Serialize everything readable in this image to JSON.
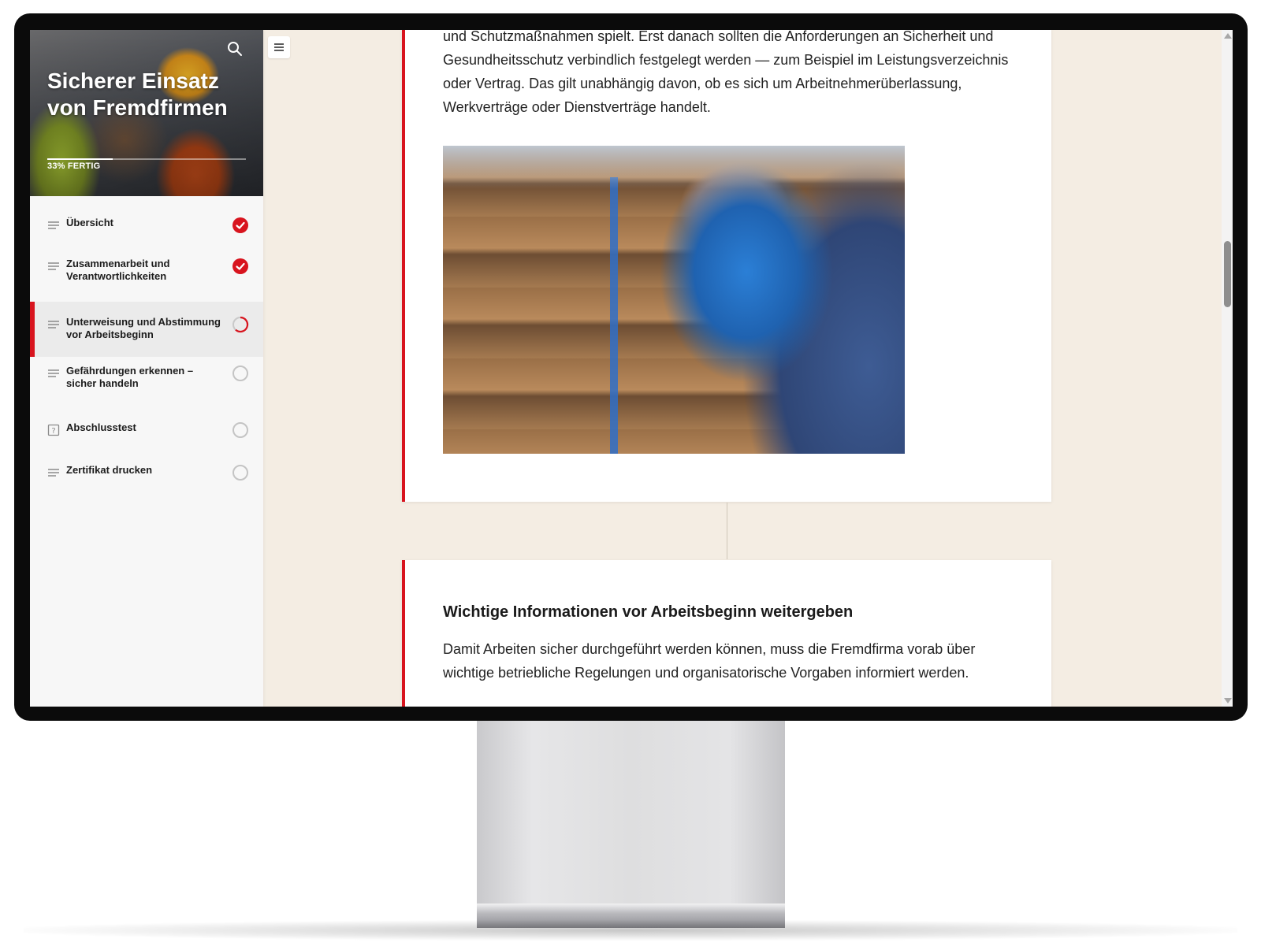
{
  "course": {
    "title": "Sicherer Einsatz von Fremdfirmen",
    "progress_label": "33% FERTIG",
    "progress_fraction": 0.33
  },
  "sidebar": {
    "items": [
      {
        "label": "Übersicht",
        "icon": "lines-icon",
        "status": "complete"
      },
      {
        "label": "Zusammenarbeit und Verantwortlichkeiten",
        "icon": "lines-icon",
        "status": "complete"
      },
      {
        "label": "Unterweisung und Abstimmung vor Arbeitsbeginn",
        "icon": "lines-icon",
        "status": "in-progress",
        "active": true
      },
      {
        "label": "Gefährdungen erkennen – sicher handeln",
        "icon": "lines-icon",
        "status": "incomplete"
      },
      {
        "label": "Abschlusstest",
        "icon": "quiz-icon",
        "status": "incomplete"
      },
      {
        "label": "Zertifikat drucken",
        "icon": "lines-icon",
        "status": "incomplete"
      }
    ]
  },
  "content": {
    "block1_text": "und Schutzmaßnahmen spielt. Erst danach sollten die Anforderungen an Sicherheit und Gesundheitsschutz verbindlich festgelegt werden — zum Beispiel im Leistungsverzeichnis oder Vertrag. Das gilt unabhängig davon, ob es sich um Arbeitnehmerüberlassung, Werkverträge oder Dienstverträge handelt.",
    "block2_heading": "Wichtige Informationen vor Arbeitsbeginn weitergeben",
    "block2_text": "Damit Arbeiten sicher durchgeführt werden können, muss die Fremdfirma vorab über wichtige betriebliche Regelungen und organisatorische Vorgaben informiert werden."
  },
  "colors": {
    "accent": "#d8141e",
    "background": "#f4ede3",
    "sidebar": "#f7f7f7"
  }
}
